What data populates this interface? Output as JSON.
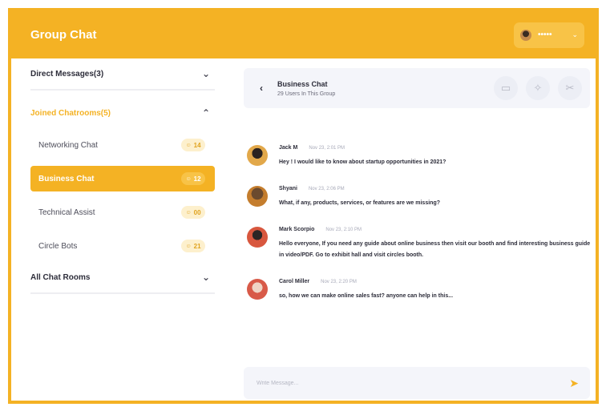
{
  "header": {
    "title": "Group Chat",
    "user_name": "•••••",
    "user_avatar_icon": "user-avatar",
    "dropdown_icon": "chevron-down-icon"
  },
  "sidebar": {
    "direct_messages": {
      "label": "Direct Messages(3)",
      "icon": "chevron-down-icon"
    },
    "joined": {
      "label": "Joined Chatrooms(5)",
      "icon": "chevron-up-icon"
    },
    "rooms": [
      {
        "name": "Networking Chat",
        "count": "14"
      },
      {
        "name": "Business Chat",
        "count": "12"
      },
      {
        "name": "Technical Assist",
        "count": "00"
      },
      {
        "name": "Circle Bots",
        "count": "21"
      }
    ],
    "all_rooms": {
      "label": "All Chat Rooms",
      "icon": "chevron-down-icon"
    }
  },
  "chat": {
    "name": "Business Chat",
    "subtitle": "29 Users In This Group",
    "actions": [
      "video-icon",
      "pin-icon",
      "scissors-icon"
    ],
    "messages": [
      {
        "sender": "Jack M",
        "time": "Nov 23, 2:01 PM",
        "text": "Hey ! I would like to  know about startup opportunities in 2021?"
      },
      {
        "sender": "Shyani",
        "time": "Nov 23, 2:06 PM",
        "text": "What, if any, products, services, or features are we missing?"
      },
      {
        "sender": "Mark Scorpio",
        "time": "Nov 23, 2:10 PM",
        "text": "Hello everyone, If you need any guide about online business then visit our booth and find interesting business guide in video/PDF. Go to exhibit hall and visit circles booth."
      },
      {
        "sender": "Carol Miller",
        "time": "Nov 23, 2:20 PM",
        "text": "so, how we can make online sales fast? anyone can help in this..."
      }
    ],
    "composer_placeholder": "Write Message...",
    "send_icon": "send-icon"
  },
  "colors": {
    "accent": "#f4b224",
    "accent_light": "#fdf0cd",
    "panel": "#f4f5fa"
  }
}
